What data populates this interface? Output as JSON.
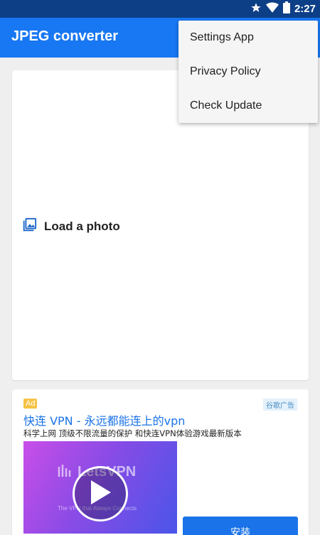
{
  "status_bar": {
    "time": "2:27",
    "icons": [
      "star-icon",
      "wifi-icon",
      "battery-icon"
    ]
  },
  "app_bar": {
    "title": "JPEG converter"
  },
  "overflow_menu": {
    "items": [
      {
        "label": "Settings App"
      },
      {
        "label": "Privacy Policy"
      },
      {
        "label": "Check Update"
      }
    ]
  },
  "photo_card": {
    "load_label": "Load a photo",
    "icon": "image-gallery-icon"
  },
  "ad": {
    "badge": "Ad",
    "network_label": "谷歌广告",
    "title": "快连 VPN - 永远都能连上的vpn",
    "description": "科学上网 顶级不限流量的保护 和快连VPN体验游戏最新版本",
    "video": {
      "brand": "LetsVPN",
      "tagline": "The VPN that Always Connects"
    },
    "install_label": "安装"
  },
  "colors": {
    "status_bar": "#0d3f86",
    "app_bar": "#1877f2",
    "accent": "#1a73e8",
    "ad_badge": "#f6c244",
    "background": "#efefef"
  }
}
